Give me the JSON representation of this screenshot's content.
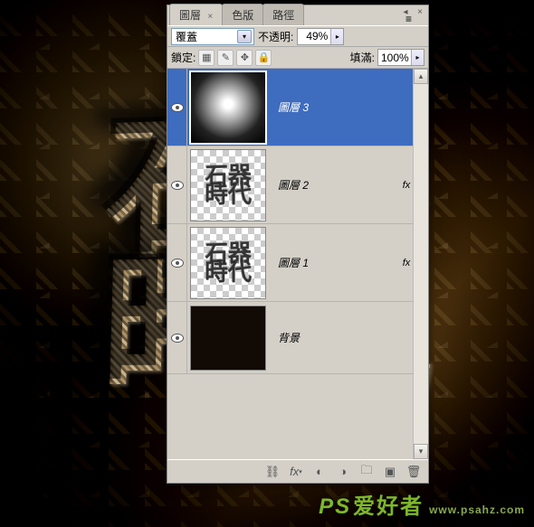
{
  "panel": {
    "tabs": [
      {
        "label": "圖層",
        "active": true
      },
      {
        "label": "色版",
        "active": false
      },
      {
        "label": "路徑",
        "active": false
      }
    ],
    "blend_mode": "覆蓋",
    "opacity_label": "不透明:",
    "opacity_value": "49%",
    "lock_label": "鎖定:",
    "fill_label": "填滿:",
    "fill_value": "100%",
    "layers": [
      {
        "name": "圖層 3",
        "visible": true,
        "selected": true,
        "thumb": "radial",
        "fx": false,
        "locked": false
      },
      {
        "name": "圖層 2",
        "visible": true,
        "selected": false,
        "thumb": "checker",
        "fx": true,
        "locked": false
      },
      {
        "name": "圖層 1",
        "visible": true,
        "selected": false,
        "thumb": "checker",
        "fx": true,
        "locked": false
      },
      {
        "name": "背景",
        "visible": true,
        "selected": false,
        "thumb": "solid",
        "fx": false,
        "locked": true
      }
    ],
    "fx_label": "fx",
    "thumb_text": "石器\n時代",
    "footer_icons": [
      "link-icon",
      "fx-icon",
      "mask-icon",
      "adjust-icon",
      "group-icon",
      "new-layer-icon",
      "trash-icon"
    ]
  },
  "watermark": {
    "brand": "PS",
    "text": "爱好者",
    "sub": "www.psahz.com"
  }
}
